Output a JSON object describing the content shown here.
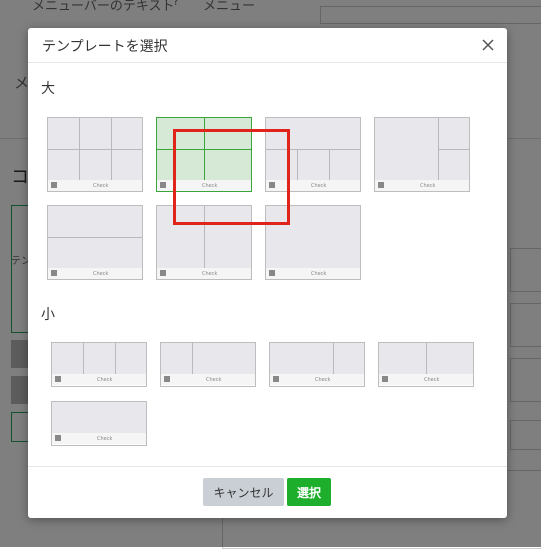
{
  "background": {
    "menubar_text_label": "メニューバーのテキスト",
    "menu_radio_label": "メニュー",
    "partial_label_me": "メ",
    "partial_label_co": "コ",
    "partial_label_te": "テン"
  },
  "modal": {
    "title": "テンプレートを選択",
    "close_icon": "close-icon",
    "large_section_label": "大",
    "small_section_label": "小",
    "card_check_label": "Check",
    "selected_template": "large-2",
    "highlight_color": "#e0241c",
    "accent_color": "#1daf2c"
  },
  "footer": {
    "cancel_label": "キャンセル",
    "select_label": "選択"
  }
}
